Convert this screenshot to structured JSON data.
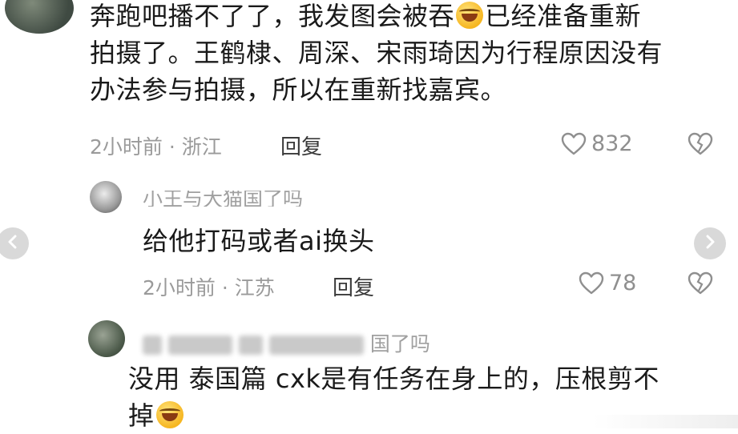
{
  "comments": [
    {
      "text_parts": [
        "奔跑吧播不了了，我发图会被吞",
        "已经准备重新",
        "拍摄了。王鹤棣、周深、宋雨琦因为行程原因没有",
        "办法参与拍摄，所以在重新找嘉宾。"
      ],
      "emoji": "grinning-squinting-face",
      "time_location": "2小时前 · 浙江",
      "reply_label": "回复",
      "likes": "832"
    },
    {
      "username": "小王与大猫国了吗",
      "text": "给他打码或者ai换头",
      "time_location": "2小时前 · 江苏",
      "reply_label": "回复",
      "likes": "78"
    },
    {
      "username": "国了吗",
      "text_line1": "没用 泰国篇 cxk是有任务在身上的，压根剪不",
      "text_line2": "掉",
      "emoji": "grinning-squinting-face"
    }
  ],
  "colors": {
    "text": "#1a1a1a",
    "meta": "#9a9a9a",
    "icon": "#8f8f8f"
  },
  "icons": {
    "like": "heart-outline-icon",
    "dislike": "broken-heart-icon",
    "prev": "chevron-left-icon",
    "next": "chevron-right-icon"
  }
}
